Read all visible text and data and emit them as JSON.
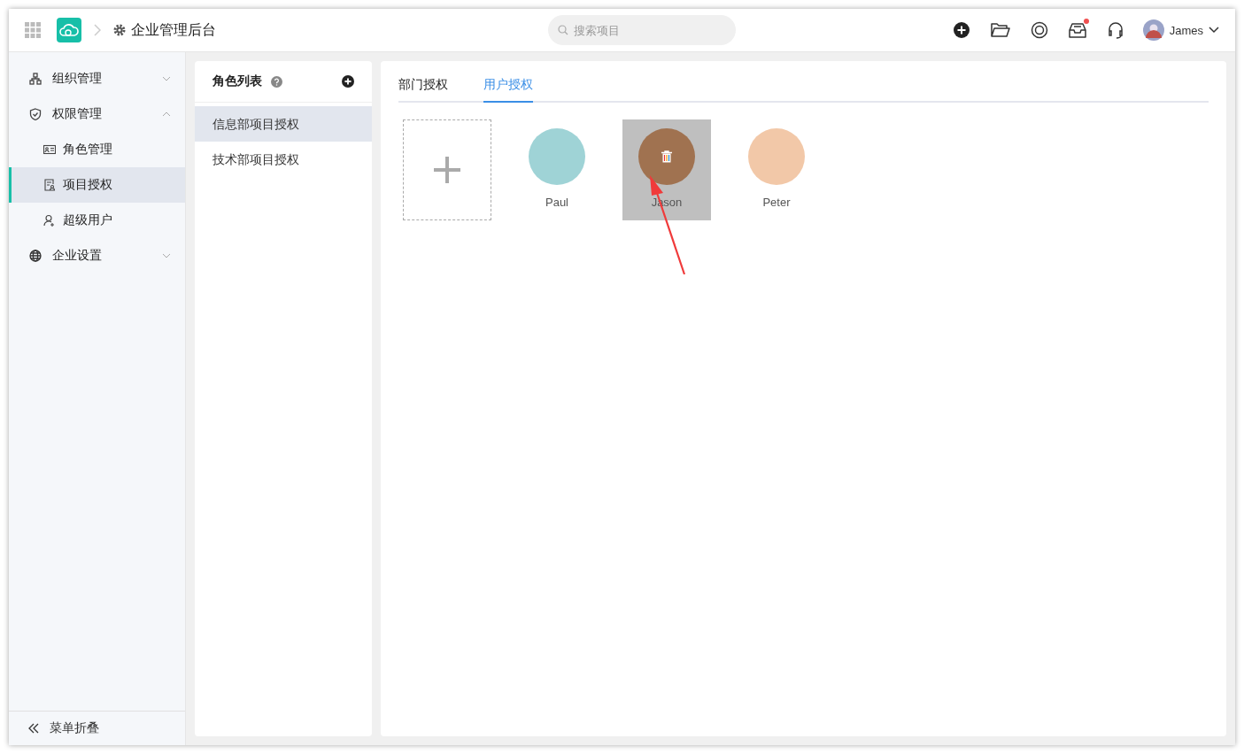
{
  "header": {
    "title": "企业管理后台",
    "search": {
      "placeholder": "搜索项目"
    },
    "notification_dot": true,
    "user": {
      "name": "James"
    }
  },
  "sidebar": {
    "items": [
      {
        "label": "组织管理",
        "expanded": false,
        "selected": false
      },
      {
        "label": "权限管理",
        "expanded": true,
        "selected": false,
        "children": [
          {
            "label": "角色管理",
            "selected": false
          },
          {
            "label": "项目授权",
            "selected": true
          },
          {
            "label": "超级用户",
            "selected": false
          }
        ]
      },
      {
        "label": "企业设置",
        "expanded": false,
        "selected": false
      }
    ],
    "collapse_label": "菜单折叠"
  },
  "roles": {
    "title": "角色列表",
    "items": [
      {
        "label": "信息部项目授权",
        "selected": true
      },
      {
        "label": "技术部项目授权",
        "selected": false
      }
    ]
  },
  "tabs": [
    {
      "label": "部门授权",
      "selected": false
    },
    {
      "label": "用户授权",
      "selected": true
    }
  ],
  "users": [
    {
      "name": "Paul",
      "color": "#9fd3d6",
      "hovered": false
    },
    {
      "name": "Jason",
      "color": "#a07250",
      "hovered": true
    },
    {
      "name": "Peter",
      "color": "#f2c8a8",
      "hovered": false
    }
  ]
}
